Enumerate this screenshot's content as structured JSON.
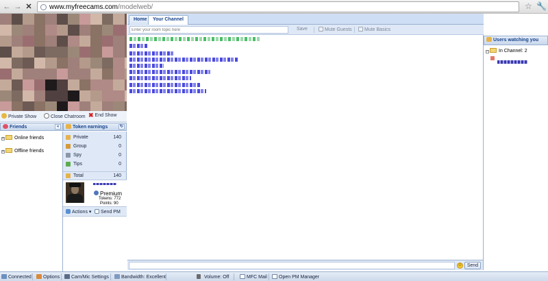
{
  "browser": {
    "url_host": "www.myfreecams.com",
    "url_path": "/modelweb/"
  },
  "show_controls": {
    "private_show": "Private Show",
    "close_chatroom": "Close Chatroom",
    "end_show": "End Show"
  },
  "friends": {
    "title": "Friends",
    "groups": [
      "Online friends",
      "Offline friends"
    ]
  },
  "earnings": {
    "title": "Token earnings",
    "rows": [
      {
        "label": "Private",
        "value": "140"
      },
      {
        "label": "Group",
        "value": "0"
      },
      {
        "label": "Spy",
        "value": "0"
      },
      {
        "label": "Tips",
        "value": "0"
      }
    ],
    "total_label": "Total",
    "total_value": "140"
  },
  "profile": {
    "membership": "Premium",
    "tokens": "Tokens: 772",
    "points": "Points: 90"
  },
  "actions": {
    "actions_label": "Actions",
    "send_pm": "Send PM"
  },
  "tabs": [
    {
      "label": "Home"
    },
    {
      "label": "Your Channel"
    }
  ],
  "topic": {
    "placeholder": "Enter your room topic here",
    "save": "Save",
    "mute_guests": "Mute Guests",
    "mute_basics": "Mute Basics"
  },
  "chat": {
    "send": "Send"
  },
  "users": {
    "title": "Users watching you",
    "channel": "In Channel: 2"
  },
  "status": {
    "connected": "Connected",
    "options": "Options",
    "cam_mic": "Cam/Mic Settings",
    "bandwidth": "Bandwidth: Excellent",
    "volume": "Volume: Off",
    "mail": "MFC Mail",
    "pm_manager": "Open PM Manager"
  },
  "colors": {
    "accent": "#15428b",
    "panel": "#dfe8f6",
    "border": "#99b0cf"
  }
}
